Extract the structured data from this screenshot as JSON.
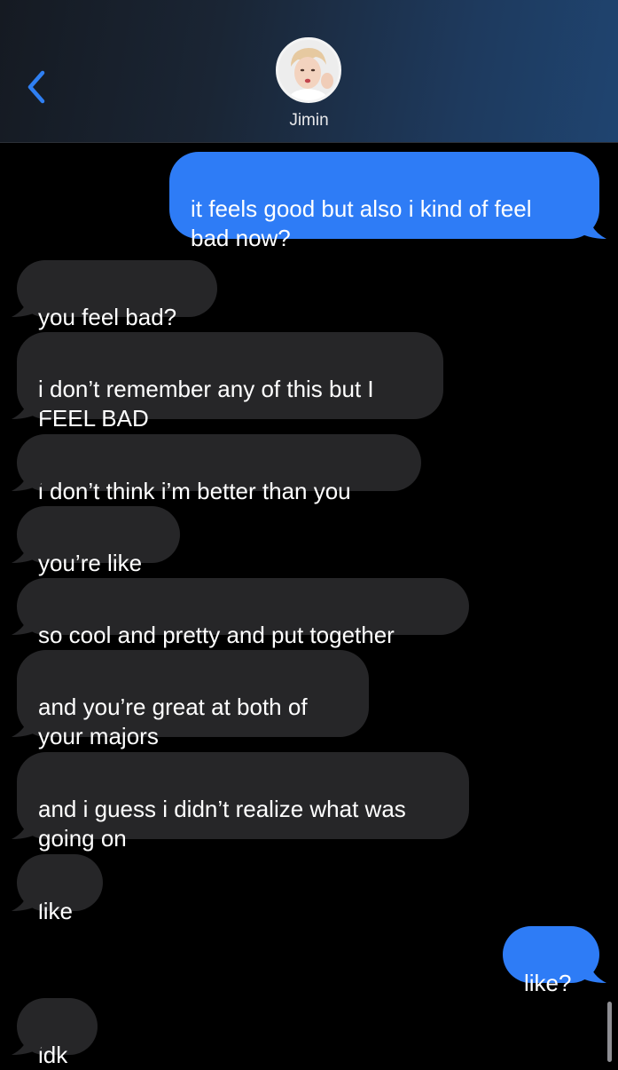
{
  "header": {
    "contact_name": "Jimin",
    "back_icon": "chevron-left-icon",
    "avatar_icon": "contact-avatar",
    "gradient": [
      "#151a22",
      "#1f4470"
    ]
  },
  "colors": {
    "incoming_bubble": "#262628",
    "outgoing_bubble": "#2e7cf6",
    "accent": "#2f7ff2"
  },
  "messages": [
    {
      "side": "out",
      "text": "it feels good but also i kind of feel\nbad now?"
    },
    {
      "side": "in",
      "text": "you feel bad?"
    },
    {
      "side": "in",
      "text": "i don’t remember any of this but I\nFEEL BAD"
    },
    {
      "side": "in",
      "text": "i don’t think i’m better than you"
    },
    {
      "side": "in",
      "text": "you’re like"
    },
    {
      "side": "in",
      "text": "so cool and pretty and put together"
    },
    {
      "side": "in",
      "text": "and you’re great at both of\nyour majors"
    },
    {
      "side": "in",
      "text": "and i guess i didn’t realize what was\ngoing on"
    },
    {
      "side": "in",
      "text": "like"
    },
    {
      "side": "out",
      "text": "like?"
    },
    {
      "side": "in",
      "text": "idk"
    }
  ]
}
